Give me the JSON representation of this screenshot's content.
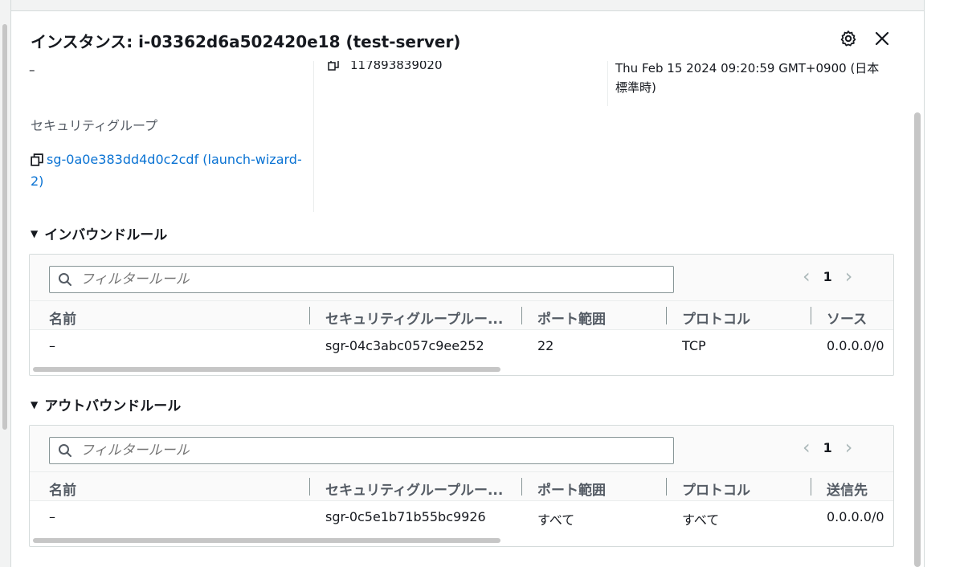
{
  "panel": {
    "title": "インスタンス: i-03362d6a502420e18 (test-server)"
  },
  "details": {
    "dash_value": "–",
    "account_id": "117893839020",
    "date_line1": "Thu Feb 15 2024 09:20:59 GMT+0900 (日本",
    "date_line2": "標準時)",
    "security_group_label": "セキュリティグループ",
    "security_group_link": "sg-0a0e383dd4d0c2cdf (launch-wizard-2)"
  },
  "inbound": {
    "heading": "インバウンドルール",
    "filter_placeholder": "フィルタールール",
    "page": "1",
    "columns": [
      "名前",
      "セキュリティグループルー...",
      "ポート範囲",
      "プロトコル",
      "ソース"
    ],
    "rows": [
      [
        "–",
        "sgr-04c3abc057c9ee252",
        "22",
        "TCP",
        "0.0.0.0/0"
      ]
    ]
  },
  "outbound": {
    "heading": "アウトバウンドルール",
    "filter_placeholder": "フィルタールール",
    "page": "1",
    "columns": [
      "名前",
      "セキュリティグループルー...",
      "ポート範囲",
      "プロトコル",
      "送信先"
    ],
    "rows": [
      [
        "–",
        "sgr-0c5e1b71b55bc9926",
        "すべて",
        "すべて",
        "0.0.0.0/0"
      ]
    ]
  },
  "colors": {
    "link": "#0972d3",
    "text": "#16191f",
    "muted": "#545b64"
  }
}
